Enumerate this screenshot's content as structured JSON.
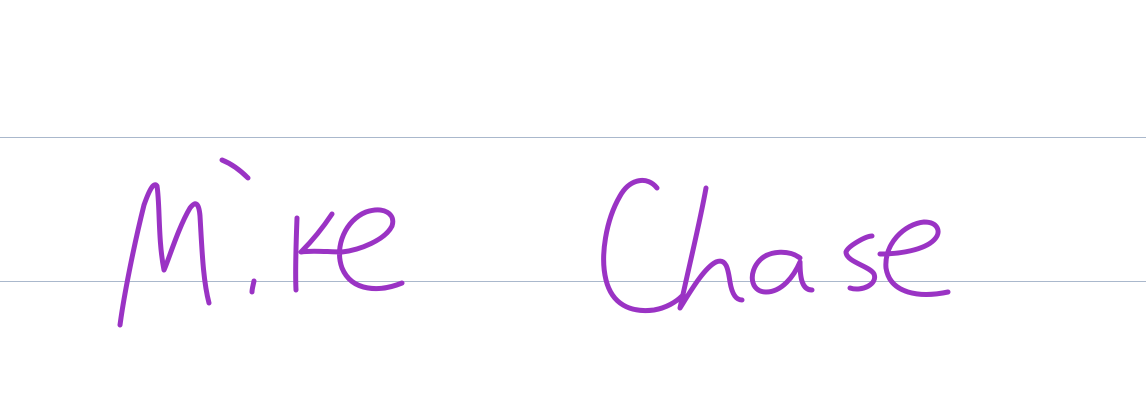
{
  "signature": {
    "text": "Mike Chase",
    "ink_color": "#9a33c4"
  },
  "guide_lines": {
    "color": "#aab8cc"
  }
}
